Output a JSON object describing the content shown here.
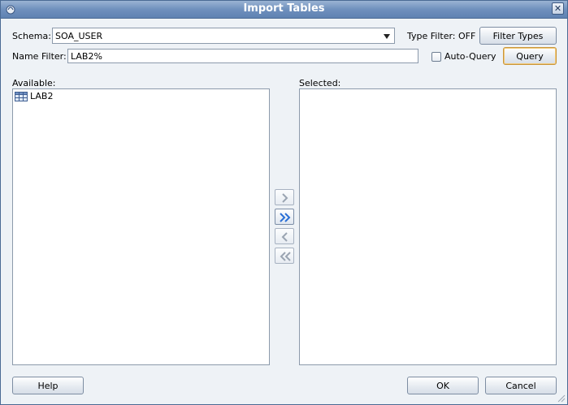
{
  "window": {
    "title": "Import Tables"
  },
  "schema": {
    "label": "Schema:",
    "value": "SOA_USER"
  },
  "type_filter": {
    "label": "Type Filter: OFF"
  },
  "buttons": {
    "filter_types": "Filter Types",
    "query": "Query",
    "help": "Help",
    "ok": "OK",
    "cancel": "Cancel"
  },
  "name_filter": {
    "label": "Name Filter:",
    "value": "LAB2%"
  },
  "auto_query": {
    "label": "Auto-Query",
    "checked": false
  },
  "available": {
    "label": "Available:",
    "items": [
      "LAB2"
    ]
  },
  "selected": {
    "label": "Selected:",
    "items": []
  },
  "shuttle": {
    "icons": [
      "move-right-icon",
      "move-all-right-icon",
      "move-left-icon",
      "move-all-left-icon"
    ]
  },
  "colors": {
    "title_bar": "#6f90bd",
    "dialog_bg": "#eef2f6",
    "accent_arrow": "#2a6fd6",
    "default_button_border": "#c9953a"
  }
}
